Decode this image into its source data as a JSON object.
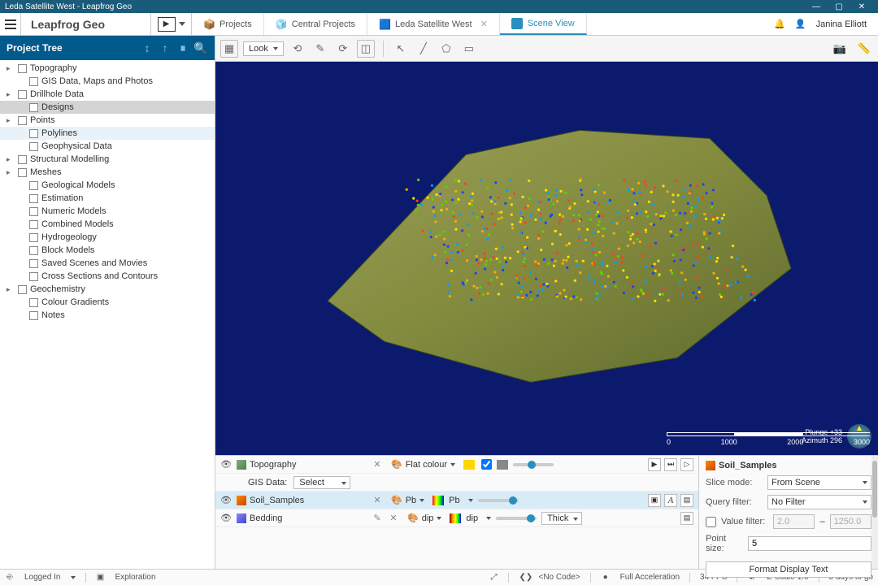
{
  "titlebar": {
    "text": "Leda Satellite West - Leapfrog Geo"
  },
  "appheader": {
    "title": "Leapfrog Geo",
    "tabs": [
      {
        "label": "Projects",
        "closable": false
      },
      {
        "label": "Central Projects",
        "closable": false
      },
      {
        "label": "Leda Satellite West",
        "closable": true
      },
      {
        "label": "Scene View",
        "closable": false
      }
    ],
    "user": "Janina Elliott"
  },
  "sidebar": {
    "title": "Project Tree",
    "items": [
      {
        "label": "Topography",
        "expander": true,
        "indent": 0
      },
      {
        "label": "GIS Data, Maps and Photos",
        "expander": false,
        "indent": 1
      },
      {
        "label": "Drillhole Data",
        "expander": true,
        "indent": 0
      },
      {
        "label": "Designs",
        "expander": false,
        "indent": 1,
        "selected": true
      },
      {
        "label": "Points",
        "expander": true,
        "indent": 0
      },
      {
        "label": "Polylines",
        "expander": false,
        "indent": 1,
        "hover": true
      },
      {
        "label": "Geophysical Data",
        "expander": false,
        "indent": 1
      },
      {
        "label": "Structural Modelling",
        "expander": true,
        "indent": 0
      },
      {
        "label": "Meshes",
        "expander": true,
        "indent": 0
      },
      {
        "label": "Geological Models",
        "expander": false,
        "indent": 1
      },
      {
        "label": "Estimation",
        "expander": false,
        "indent": 1
      },
      {
        "label": "Numeric Models",
        "expander": false,
        "indent": 1
      },
      {
        "label": "Combined Models",
        "expander": false,
        "indent": 1
      },
      {
        "label": "Hydrogeology",
        "expander": false,
        "indent": 1
      },
      {
        "label": "Block Models",
        "expander": false,
        "indent": 1
      },
      {
        "label": "Saved Scenes and Movies",
        "expander": false,
        "indent": 1
      },
      {
        "label": "Cross Sections and Contours",
        "expander": false,
        "indent": 1
      },
      {
        "label": "Geochemistry",
        "expander": true,
        "indent": 0
      },
      {
        "label": "Colour Gradients",
        "expander": false,
        "indent": 1
      },
      {
        "label": "Notes",
        "expander": false,
        "indent": 1
      }
    ]
  },
  "toolbar": {
    "look": "Look"
  },
  "viewport": {
    "plunge_label": "Plunge +33",
    "azimuth_label": "Azimuth 296",
    "scale": {
      "v0": "0",
      "v1": "1000",
      "v2": "2000",
      "v3": "3000"
    }
  },
  "scene": {
    "rows": [
      {
        "name": "Topography",
        "colour_label": "Flat colour"
      },
      {
        "name": "Soil_Samples",
        "attr": "Pb",
        "legend": "Pb"
      },
      {
        "name": "Bedding",
        "attr": "dip",
        "legend": "dip",
        "style": "Thick"
      }
    ],
    "gis_label": "GIS Data:",
    "gis_select": "Select"
  },
  "props": {
    "title": "Soil_Samples",
    "slice_label": "Slice mode:",
    "slice_value": "From Scene",
    "query_label": "Query filter:",
    "query_value": "No Filter",
    "valuefilter_label": "Value filter:",
    "vf_lo": "2.0",
    "vf_hi": "1250.0",
    "pointsize_label": "Point size:",
    "pointsize_value": "5",
    "format_btn": "Format Display Text"
  },
  "status": {
    "login": "Logged In",
    "project": "Exploration",
    "code": "<No Code>",
    "accel": "Full Acceleration",
    "fps": "34 FPS",
    "zscale": "Z-Scale 1.0",
    "days": "5 days to go"
  }
}
